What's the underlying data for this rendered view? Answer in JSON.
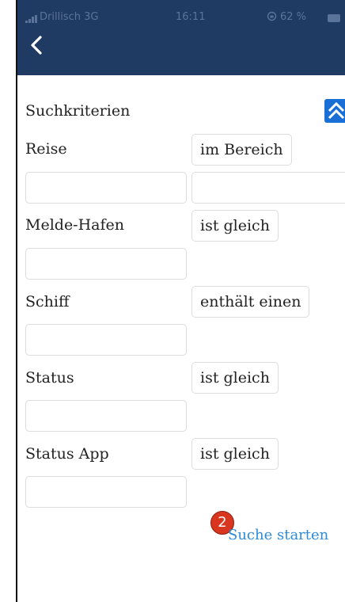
{
  "status_bar": {
    "carrier": "Drillisch  3G",
    "time": "16:11",
    "battery": "62 %"
  },
  "header": {
    "back_icon": "chevron-left-icon",
    "background_color": "#1f3b64"
  },
  "search": {
    "title": "Suchkriterien",
    "collapse_icon": "double-chevron-up-icon",
    "criteria": [
      {
        "label": "Reise",
        "operator": "im Bereich",
        "value": "",
        "value_to": ""
      },
      {
        "label": "Melde-Hafen",
        "operator": "ist gleich",
        "value": ""
      },
      {
        "label": "Schiff",
        "operator": "enthält einen",
        "value": ""
      },
      {
        "label": "Status",
        "operator": "ist gleich",
        "value": ""
      },
      {
        "label": "Status App",
        "operator": "ist gleich",
        "value": ""
      }
    ],
    "start_label": "Suche starten",
    "annotation_badge": "2"
  },
  "colors": {
    "link": "#2e8bd8",
    "accent_button": "#1a6fd6",
    "badge": "#d9361f"
  }
}
